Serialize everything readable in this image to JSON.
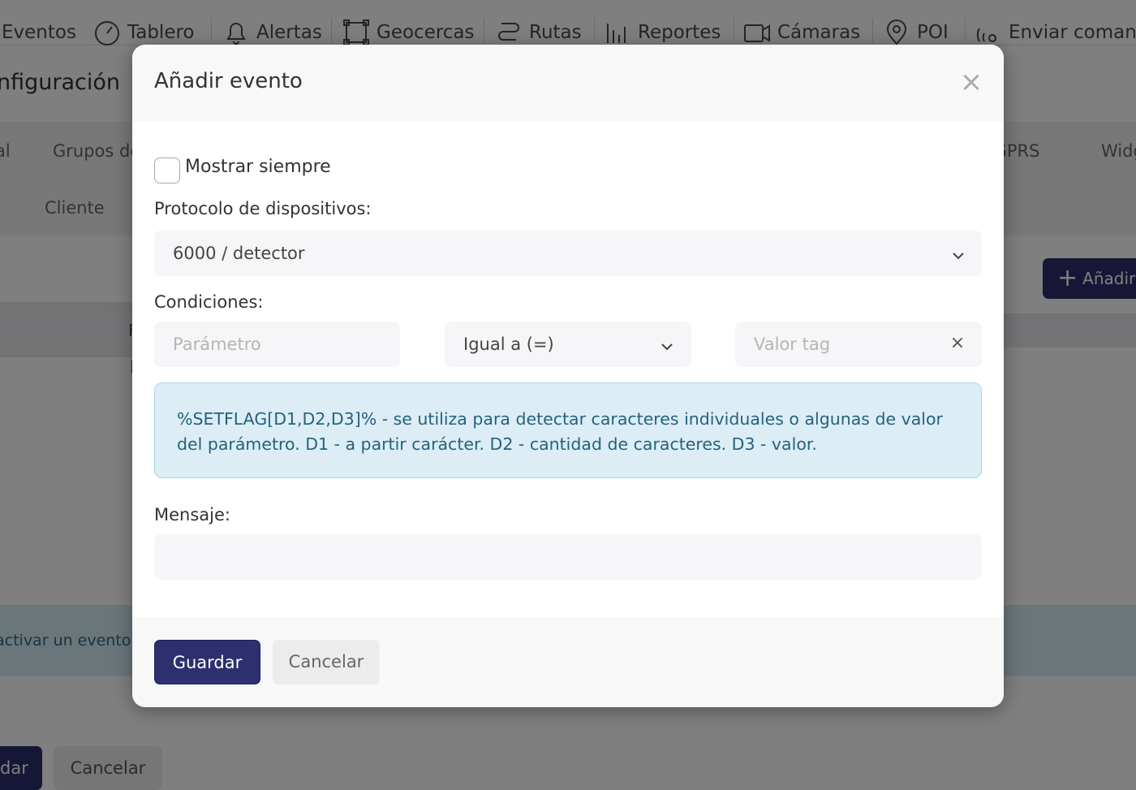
{
  "background": {
    "nav": [
      {
        "label": "Eventos",
        "icon": "none"
      },
      {
        "label": "Tablero",
        "icon": "gauge-icon"
      },
      {
        "label": "Alertas",
        "icon": "bell-icon"
      },
      {
        "label": "Geocercas",
        "icon": "geofence-icon"
      },
      {
        "label": "Rutas",
        "icon": "route-icon"
      },
      {
        "label": "Reportes",
        "icon": "bar-chart-icon"
      },
      {
        "label": "Cámaras",
        "icon": "camera-icon"
      },
      {
        "label": "POI",
        "icon": "map-pin-icon"
      },
      {
        "label": "Enviar comand",
        "icon": "satellite-icon"
      }
    ],
    "page_title": "nfiguración",
    "tabs_row1": [
      "al",
      "Grupos de",
      "e GPRS",
      "Widg"
    ],
    "tabs_row2": [
      "Cliente"
    ],
    "add_button_label": "Añadir e",
    "table_header_fragment": "F",
    "table_cell_fragment": "I",
    "info_text": "activar un evento,",
    "save_label": "dar",
    "cancel_label": "Cancelar"
  },
  "modal": {
    "title": "Añadir evento",
    "close_symbol": "×",
    "show_always_label": "Mostrar siempre",
    "show_always_checked": false,
    "protocol_label": "Protocolo de dispositivos:",
    "protocol_value": "6000 / detector",
    "conditions_label": "Condiciones:",
    "parameter_placeholder": "Parámetro",
    "parameter_value": "",
    "operator_value": "Igual a (=)",
    "tag_value_placeholder": "Valor tag",
    "tag_value": "",
    "clear_symbol": "×",
    "info_text": "%SETFLAG[D1,D2,D3]% - se utiliza para detectar caracteres individuales o algunas de valor del parámetro. D1 - a partir carácter. D2 - cantidad de caracteres. D3 - valor.",
    "message_label": "Mensaje:",
    "message_value": "",
    "save_label": "Guardar",
    "cancel_label": "Cancelar"
  },
  "colors": {
    "primary": "#2d2f6e",
    "info_bg": "#dcedf6",
    "info_text": "#24627d"
  }
}
